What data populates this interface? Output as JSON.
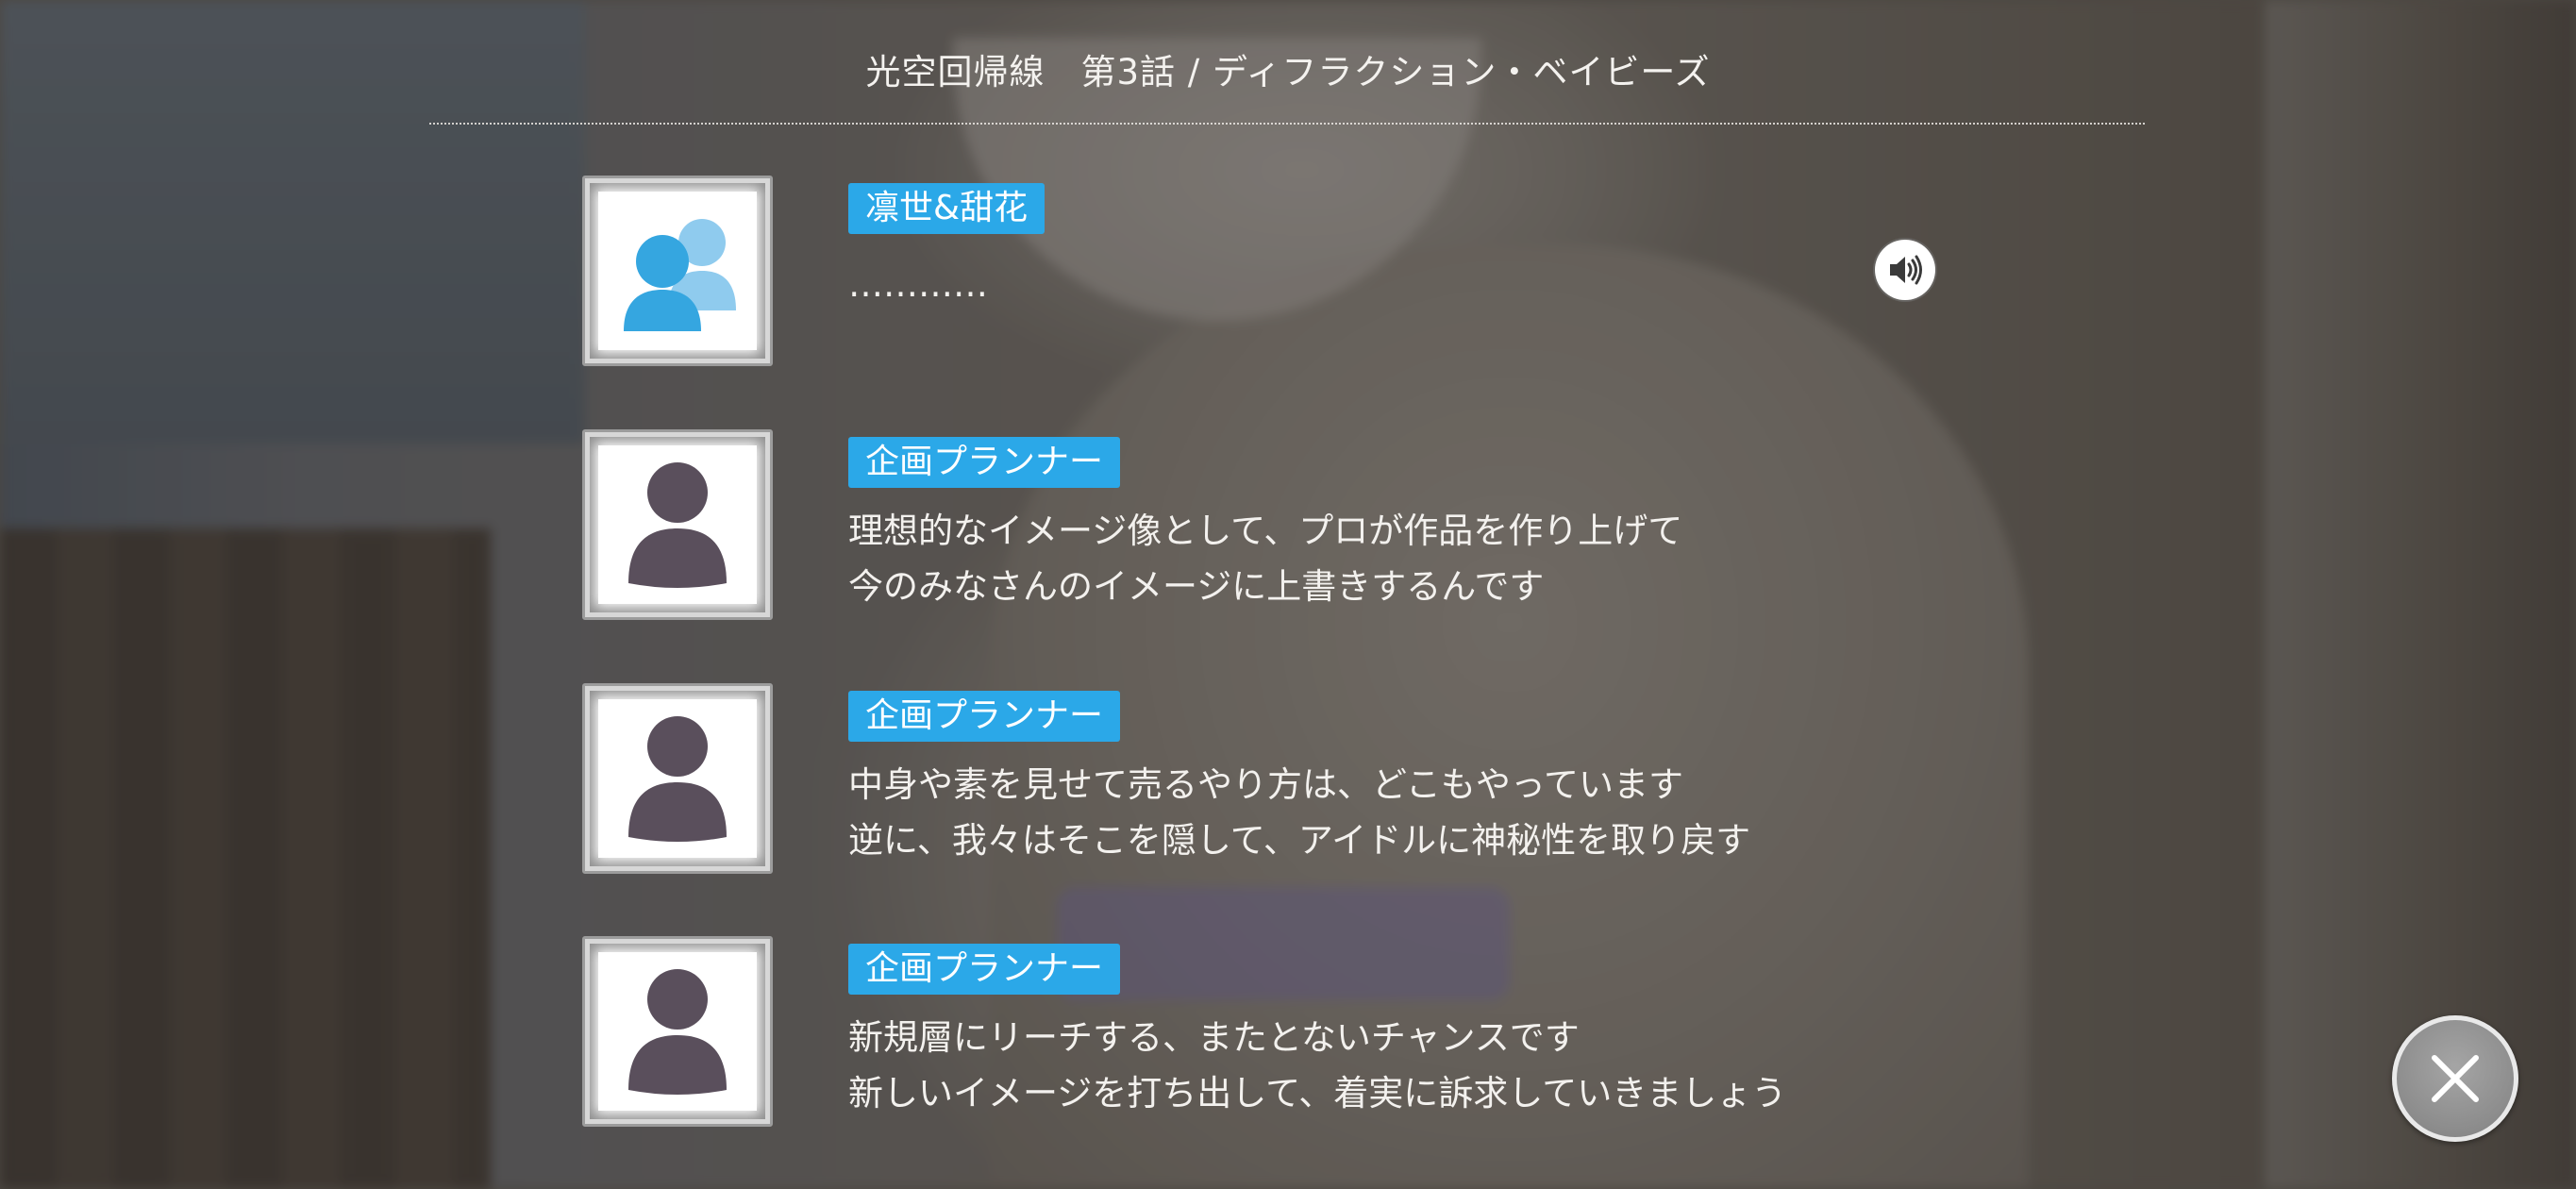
{
  "header": {
    "title": "光空回帰線　第3話 / ディフラクション・ベイビーズ"
  },
  "log": [
    {
      "speaker": "凛世&甜花",
      "avatar_icon": "group-avatar-icon",
      "lines": [
        "…………"
      ],
      "has_voice": true
    },
    {
      "speaker": "企画プランナー",
      "avatar_icon": "person-avatar-icon",
      "lines": [
        "理想的なイメージ像として、プロが作品を作り上げて",
        "今のみなさんのイメージに上書きするんです"
      ]
    },
    {
      "speaker": "企画プランナー",
      "avatar_icon": "person-avatar-icon",
      "lines": [
        "中身や素を見せて売るやり方は、どこもやっています",
        "逆に、我々はそこを隠して、アイドルに神秘性を取り戻す"
      ]
    },
    {
      "speaker": "企画プランナー",
      "avatar_icon": "person-avatar-icon",
      "lines": [
        "新規層にリーチする、またとないチャンスです",
        "新しいイメージを打ち出して、着実に訴求していきましょう"
      ]
    }
  ],
  "controls": {
    "voice_icon": "speaker-icon",
    "close_icon": "close-icon"
  },
  "colors": {
    "name_badge": "#2ba8e8",
    "group_avatar_front": "#35a6e0",
    "group_avatar_back": "#8fcbee",
    "person_avatar": "#5a4f5c"
  }
}
